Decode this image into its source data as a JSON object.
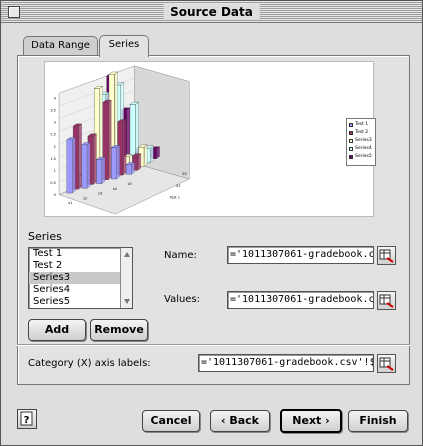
{
  "window": {
    "title": "Source Data"
  },
  "tabs": [
    {
      "label": "Data Range"
    },
    {
      "label": "Series"
    }
  ],
  "preview": {
    "legend": [
      "Test 1",
      "Test 2",
      "Series3",
      "Series4",
      "Series5"
    ],
    "x_ticks": [
      "s1",
      "s2",
      "s3",
      "s4",
      "s5"
    ],
    "z_ticks": [
      "Test 1",
      "S3",
      "S5"
    ],
    "y_ticks": [
      "0",
      "0.5",
      "1",
      "1.5",
      "2",
      "2.5",
      "3",
      "3.5",
      "4"
    ],
    "colors": [
      "#9999ff",
      "#993366",
      "#ffffcc",
      "#ccffff",
      "#660066"
    ]
  },
  "series": {
    "group_label": "Series",
    "items": [
      "Test 1",
      "Test 2",
      "Series3",
      "Series4",
      "Series5"
    ],
    "selected": "Series3",
    "add_label": "Add",
    "remove_label": "Remove",
    "name_label": "Name:",
    "name_value": "='1011307061-gradebook.c",
    "values_label": "Values:",
    "values_value": "='1011307061-gradebook.c"
  },
  "category": {
    "label": "Category (X) axis labels:",
    "value": "='1011307061-gradebook.csv'!$A"
  },
  "footer": {
    "cancel_label": "Cancel",
    "back_label": "‹ Back",
    "next_label": "Next ›",
    "finish_label": "Finish"
  }
}
